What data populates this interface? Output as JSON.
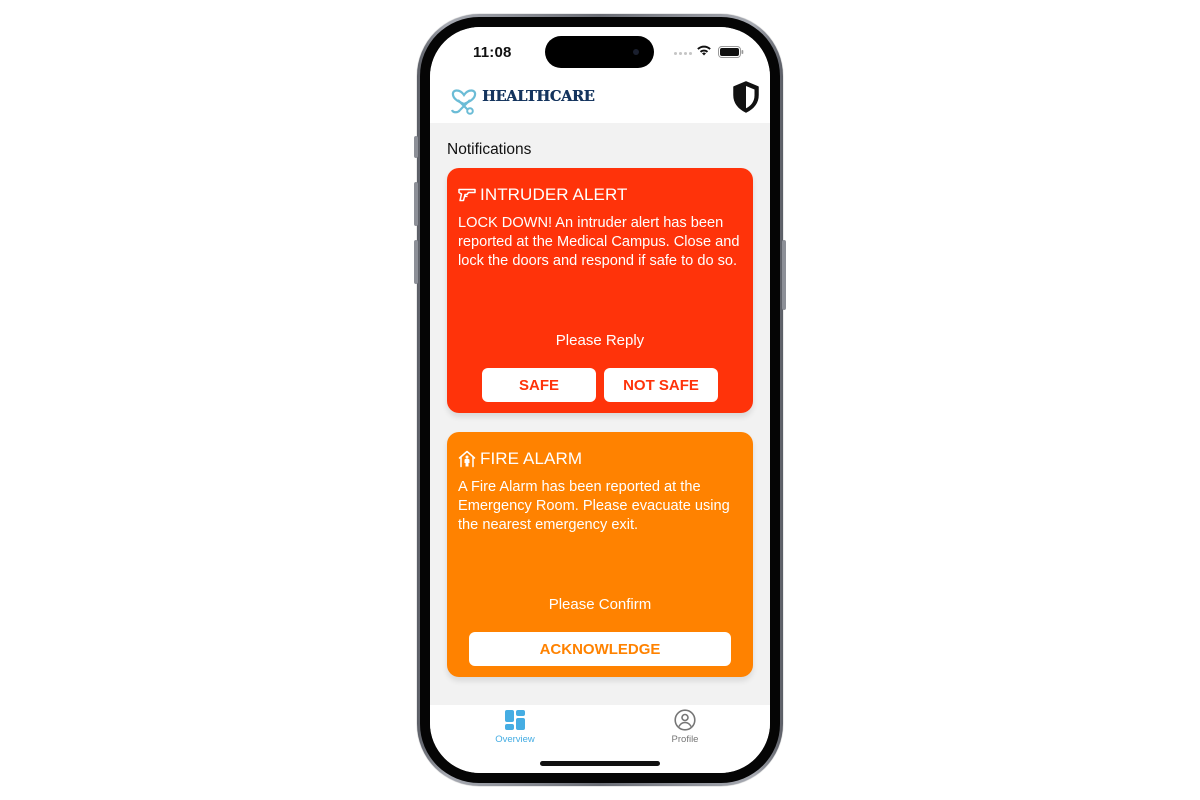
{
  "status_bar": {
    "time": "11:08"
  },
  "header": {
    "app_name": "HEALTHCARE",
    "logo_icon": "heart-stethoscope-icon",
    "security_icon": "shield-icon"
  },
  "notifications": {
    "section_title": "Notifications",
    "cards": [
      {
        "type": "intruder",
        "icon": "gun-icon",
        "title": "INTRUDER ALERT",
        "message": "LOCK DOWN! An intruder alert has been reported at the Medical Campus. Close and lock the doors and respond if safe to do so.",
        "prompt": "Please Reply",
        "actions": [
          "SAFE",
          "NOT SAFE"
        ],
        "color": "#ff330a"
      },
      {
        "type": "fire",
        "icon": "house-person-icon",
        "title": "FIRE ALARM",
        "message": "A Fire Alarm has been reported at the Emergency Room. Please evacuate using the nearest emergency exit.",
        "prompt": "Please Confirm",
        "actions": [
          "ACKNOWLEDGE"
        ],
        "color": "#ff8200"
      }
    ]
  },
  "tab_bar": {
    "tabs": [
      {
        "label": "Overview",
        "icon": "dashboard-icon",
        "active": true
      },
      {
        "label": "Profile",
        "icon": "user-circle-icon",
        "active": false
      }
    ],
    "active_color": "#45ade3",
    "inactive_color": "#767676"
  }
}
